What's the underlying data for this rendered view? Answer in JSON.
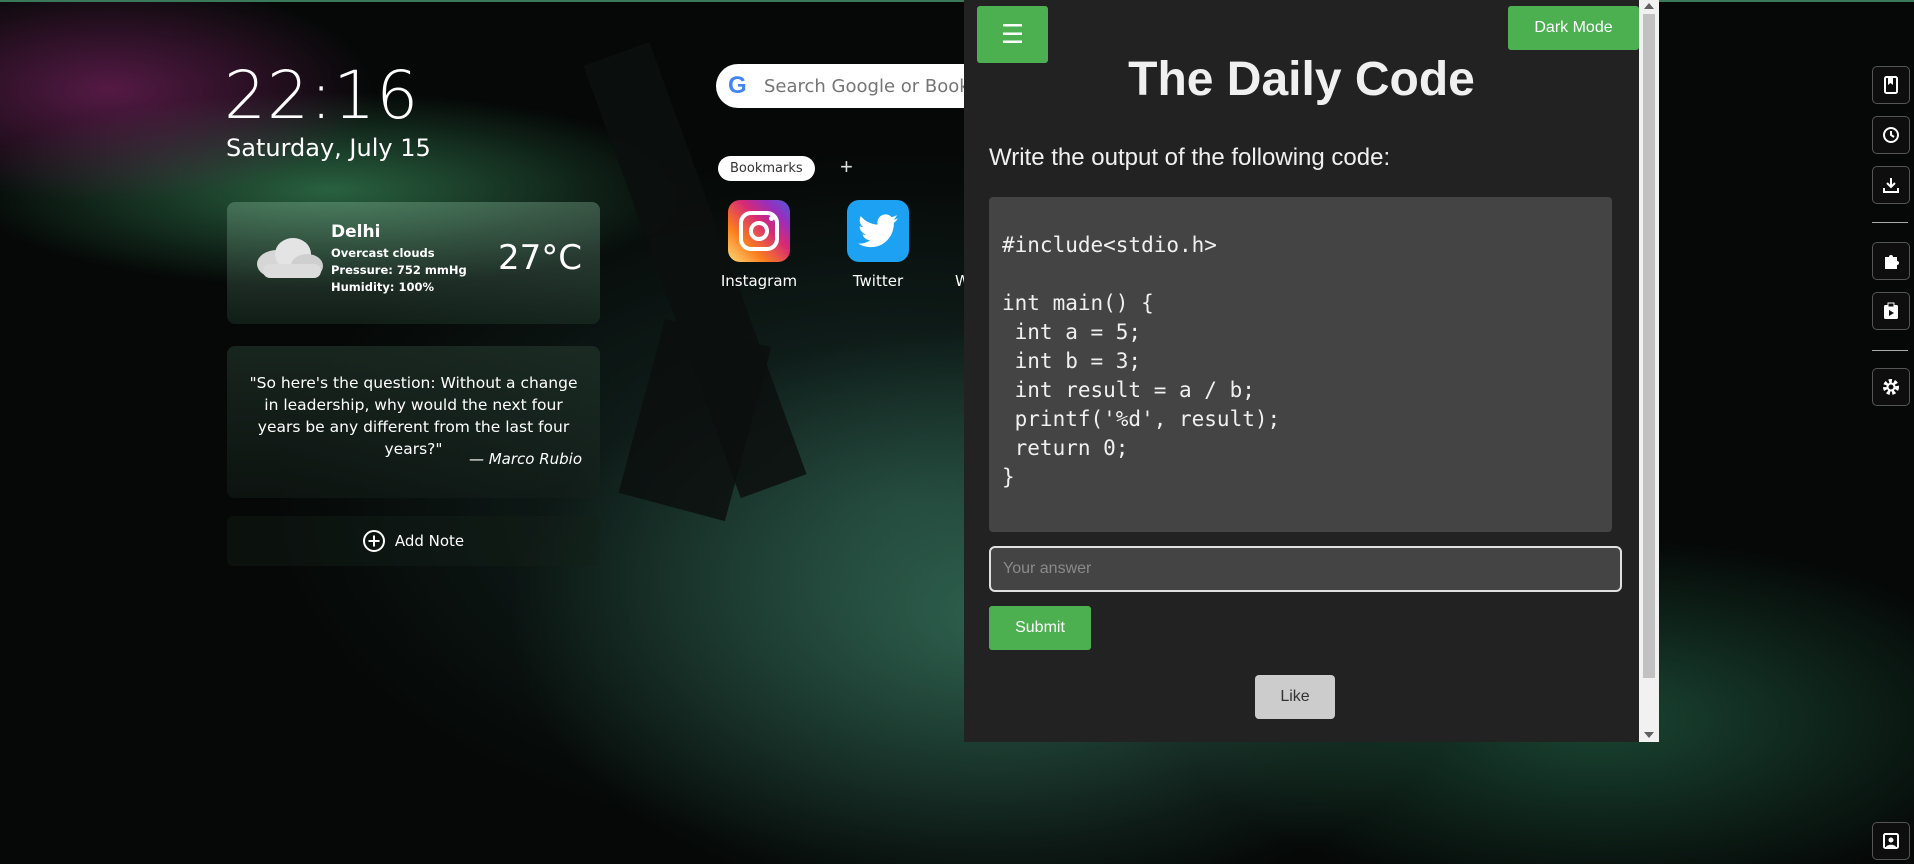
{
  "newtab": {
    "time": "22:16",
    "date": "Saturday, July 15",
    "weather": {
      "city": "Delhi",
      "condition": "Overcast clouds",
      "pressure": "Pressure: 752 mmHg",
      "humidity": "Humidity: 100%",
      "temperature": "27°C",
      "icon": "cloud-icon"
    },
    "quote": {
      "text": "\"So here's the question: Without a change in leadership, why would the next four years be any different from the last four years?\"",
      "author": "— Marco Rubio"
    },
    "add_note_label": "Add Note",
    "search_placeholder": "Search Google or Bookm",
    "bookmarks_label": "Bookmarks",
    "add_bookmark_label": "+",
    "shortcuts": [
      {
        "label": "Instagram",
        "icon": "instagram-icon"
      },
      {
        "label": "Twitter",
        "icon": "twitter-icon"
      },
      {
        "label": "W",
        "icon": "partial"
      }
    ],
    "right_toolbar": [
      "bookmarks-icon",
      "history-icon",
      "downloads-icon",
      "extensions-icon",
      "clipboard-icon",
      "settings-icon",
      "wallpaper-icon"
    ]
  },
  "popup": {
    "menu_icon": "☰",
    "dark_mode_label": "Dark Mode",
    "title": "The Daily Code",
    "prompt": "Write the output of the following code:",
    "code": "#include<stdio.h>\n\nint main() {\n int a = 5;\n int b = 3;\n int result = a / b;\n printf('%d', result);\n return 0;\n}",
    "answer_placeholder": "Your answer",
    "answer_value": "",
    "submit_label": "Submit",
    "like_label": "Like"
  },
  "colors": {
    "accent": "#4caf50",
    "popup_bg": "#222222",
    "code_bg": "#444444"
  }
}
